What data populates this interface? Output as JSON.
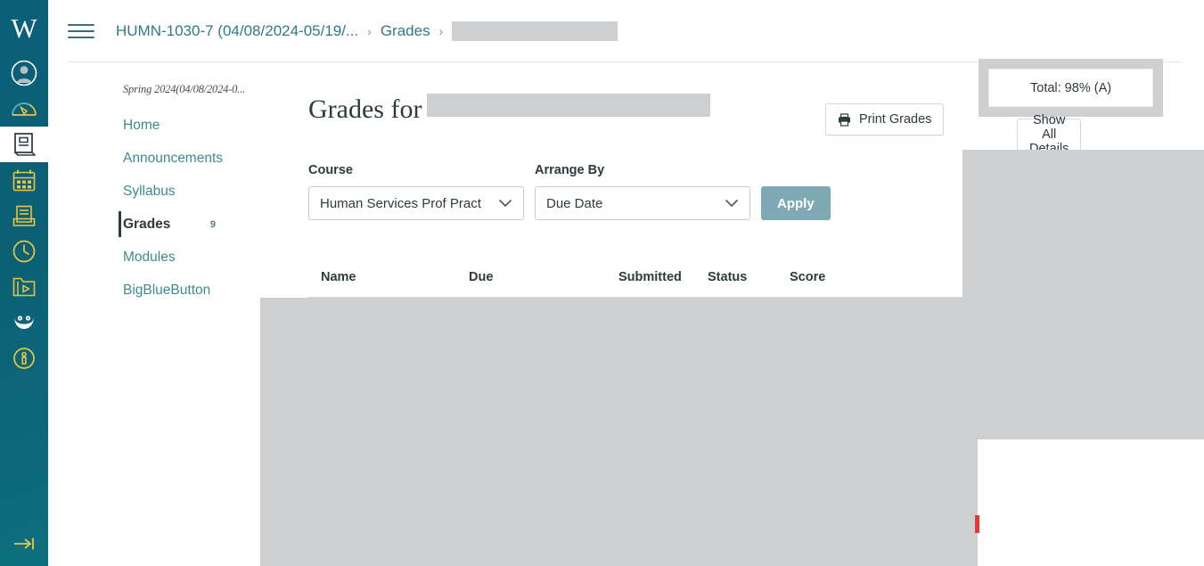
{
  "global_nav": {
    "logo_text": "W",
    "items": [
      {
        "name": "account",
        "icon": "account-avatar-icon"
      },
      {
        "name": "dashboard",
        "icon": "dashboard-gauge-icon"
      },
      {
        "name": "courses",
        "icon": "courses-book-icon",
        "active": true
      },
      {
        "name": "calendar",
        "icon": "calendar-icon"
      },
      {
        "name": "inbox",
        "icon": "inbox-tray-icon"
      },
      {
        "name": "history",
        "icon": "history-clock-icon"
      },
      {
        "name": "studio",
        "icon": "studio-folder-play-icon"
      },
      {
        "name": "owl-tool",
        "icon": "owl-icon"
      },
      {
        "name": "help",
        "icon": "help-info-icon"
      }
    ],
    "collapse_icon": "expand-arrow-icon"
  },
  "header": {
    "menu_icon": "hamburger-menu-icon",
    "breadcrumb": [
      {
        "label": "HUMN-1030-7 (04/08/2024-05/19/...",
        "type": "link"
      },
      {
        "label": "Grades",
        "type": "link"
      },
      {
        "label": "",
        "type": "redacted"
      }
    ],
    "separator": "›"
  },
  "course_nav": {
    "term": "Spring 2024(04/08/2024-0...",
    "items": [
      {
        "label": "Home",
        "badge": ""
      },
      {
        "label": "Announcements",
        "badge": ""
      },
      {
        "label": "Syllabus",
        "badge": ""
      },
      {
        "label": "Grades",
        "badge": "9",
        "active": true
      },
      {
        "label": "Modules",
        "badge": ""
      },
      {
        "label": "BigBlueButton",
        "badge": ""
      }
    ]
  },
  "main": {
    "title_prefix": "Grades for",
    "print_button": {
      "label": "Print Grades",
      "icon": "printer-icon"
    },
    "total": {
      "label": "Total: 98% (A)"
    },
    "details_button": {
      "label": "Show All Details"
    },
    "filters": {
      "course": {
        "label": "Course",
        "value": "Human Services Prof Pract",
        "icon": "chevron-down-icon"
      },
      "arrange_by": {
        "label": "Arrange By",
        "value": "Due Date",
        "icon": "chevron-down-icon"
      },
      "apply_button": "Apply"
    },
    "table": {
      "columns": [
        "Name",
        "Due",
        "Submitted",
        "Status",
        "Score"
      ]
    }
  },
  "colors": {
    "nav_background": "#0b6074",
    "link_teal": "#2f7a85",
    "apply_button": "#7fa9b5",
    "redaction_grey": "#cdcfd1",
    "accent_yellow": "#e8c547",
    "red_marker": "#e03b3b"
  }
}
